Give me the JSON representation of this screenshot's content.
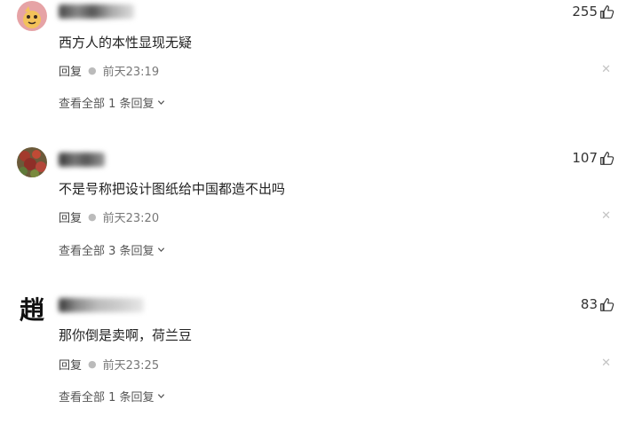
{
  "comments": [
    {
      "username": "",
      "text": "西方人的本性显现无疑",
      "likes": "255",
      "reply_label": "回复",
      "time": "前天23:19",
      "view_replies": "查看全部 1 条回复",
      "avatar_icon": "cartoon-avatar"
    },
    {
      "username": "",
      "text": "不是号称把设计图纸给中国都造不出吗",
      "likes": "107",
      "reply_label": "回复",
      "time": "前天23:20",
      "view_replies": "查看全部 3 条回复",
      "avatar_icon": "flower-photo-avatar"
    },
    {
      "username": "",
      "text": "那你倒是卖啊，荷兰豆",
      "likes": "83",
      "reply_label": "回复",
      "time": "前天23:25",
      "view_replies": "查看全部 1 条回复",
      "avatar_icon": "calligraphy-avatar",
      "avatar_char": "趙"
    }
  ]
}
